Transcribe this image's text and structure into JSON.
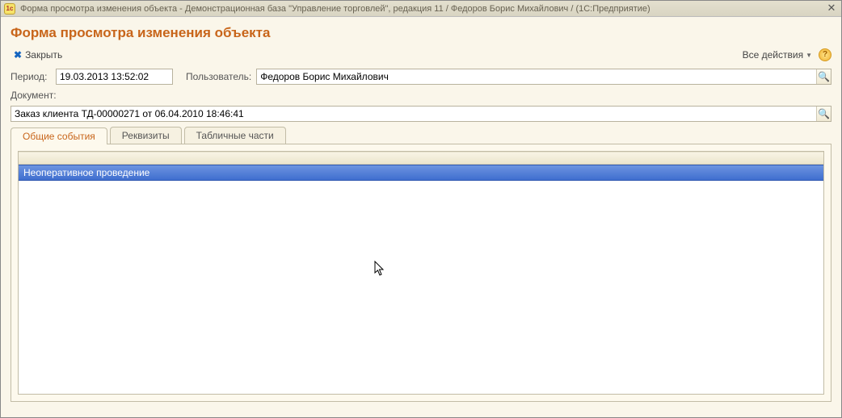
{
  "window": {
    "title": "Форма просмотра изменения объекта - Демонстрационная база \"Управление торговлей\", редакция 11 / Федоров Борис Михайлович /  (1С:Предприятие)"
  },
  "page": {
    "title": "Форма просмотра изменения объекта"
  },
  "toolbar": {
    "close_label": "Закрыть",
    "all_actions_label": "Все действия"
  },
  "fields": {
    "period_label": "Период:",
    "period_value": "19.03.2013 13:52:02",
    "user_label": "Пользователь:",
    "user_value": "Федоров Борис Михайлович",
    "document_label": "Документ:",
    "document_value": "Заказ клиента ТД-00000271 от 06.04.2010 18:46:41"
  },
  "tabs": {
    "t1": "Общие события",
    "t2": "Реквизиты",
    "t3": "Табличные части"
  },
  "events": {
    "row1": "Неоперативное проведение"
  }
}
